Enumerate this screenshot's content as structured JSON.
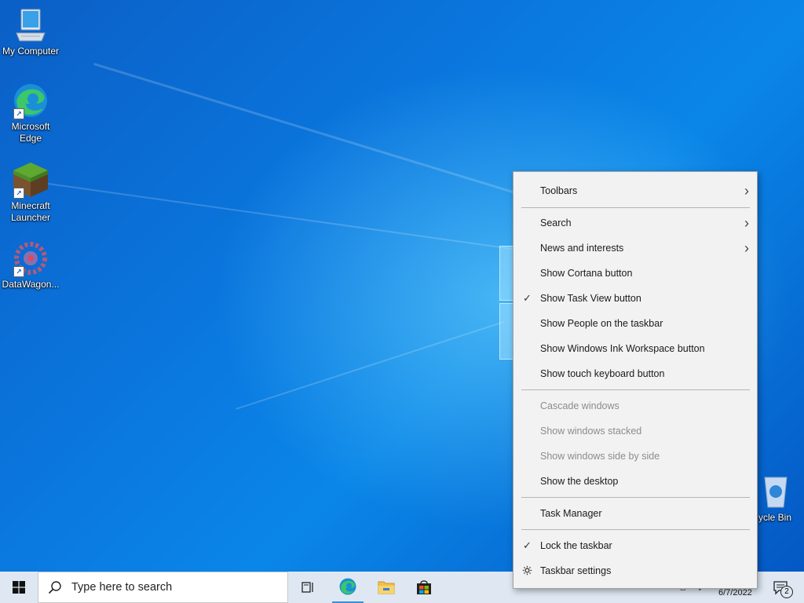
{
  "desktop": {
    "icons": [
      {
        "label": "My Computer",
        "icon": "computer-icon"
      },
      {
        "label": "Microsoft Edge",
        "icon": "edge-icon"
      },
      {
        "label": "Minecraft Launcher",
        "icon": "minecraft-icon"
      },
      {
        "label": "DataWagon...",
        "icon": "datawagon-icon"
      },
      {
        "label": "ycle Bin",
        "icon": "recycle-bin-icon"
      }
    ]
  },
  "context_menu": {
    "items": [
      {
        "label": "Toolbars",
        "submenu": true
      },
      {
        "label": "Search",
        "submenu": true
      },
      {
        "label": "News and interests",
        "submenu": true
      },
      {
        "label": "Show Cortana button"
      },
      {
        "label": "Show Task View button",
        "checked": true
      },
      {
        "label": "Show People on the taskbar"
      },
      {
        "label": "Show Windows Ink Workspace button"
      },
      {
        "label": "Show touch keyboard button"
      },
      {
        "label": "Cascade windows",
        "disabled": true
      },
      {
        "label": "Show windows stacked",
        "disabled": true
      },
      {
        "label": "Show windows side by side",
        "disabled": true
      },
      {
        "label": "Show the desktop"
      },
      {
        "label": "Task Manager"
      },
      {
        "label": "Lock the taskbar",
        "checked": true
      },
      {
        "label": "Taskbar settings",
        "icon": "gear-icon"
      }
    ],
    "check_glyph": "✓",
    "arrow_glyph": "›"
  },
  "taskbar": {
    "search_placeholder": "Type here to search",
    "pinned": [
      "task-view-icon",
      "edge-icon",
      "file-explorer-icon",
      "store-icon"
    ],
    "date": "6/7/2022",
    "notification_count": "2"
  },
  "colors": {
    "desktop_blue": "#0a6fd8",
    "taskbar": "#dfe8f2",
    "menu_bg": "#f2f2f2",
    "disabled_text": "#8c8c8c"
  }
}
